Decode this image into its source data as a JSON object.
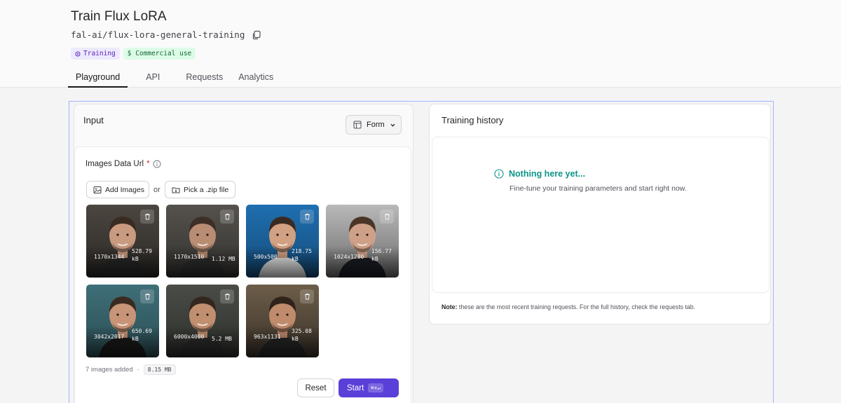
{
  "header": {
    "title": "Train Flux LoRA",
    "model_id": "fal-ai/flux-lora-general-training",
    "badges": {
      "training": "Training",
      "commercial": "$ Commercial use"
    },
    "tabs": [
      "Playground",
      "API",
      "Requests",
      "Analytics"
    ],
    "active_tab": "Playground"
  },
  "input_panel": {
    "title": "Input",
    "form_button": "Form",
    "field_label": "Images Data Url",
    "required_marker": "*",
    "add_images": "Add Images",
    "or": "or",
    "pick_zip": "Pick a .zip file",
    "images": [
      {
        "dimensions": "1170x1344",
        "size": "528.79 kB"
      },
      {
        "dimensions": "1170x1510",
        "size": "1.12 MB"
      },
      {
        "dimensions": "500x500",
        "size": "218.75 kB"
      },
      {
        "dimensions": "1024x1280",
        "size": "156.77 kB"
      },
      {
        "dimensions": "3042x2017",
        "size": "650.69 kB"
      },
      {
        "dimensions": "6000x4000",
        "size": "5.2 MB"
      },
      {
        "dimensions": "963x1131",
        "size": "325.08 kB"
      }
    ],
    "summary": "7 images added",
    "separator": "·",
    "total_size": "8.15 MB",
    "reset": "Reset",
    "start": "Start",
    "start_shortcut": "⌘+↵"
  },
  "history_panel": {
    "title": "Training history",
    "empty_title": "Nothing here yet...",
    "empty_subtitle": "Fine-tune your training parameters and start right now.",
    "note_label": "Note:",
    "note_text": " these are the most recent training requests. For the full history, check the requests tab."
  },
  "colors": {
    "accent": "#5b3fd9",
    "teal": "#0d9488",
    "frame_border": "#a5b4fc"
  }
}
